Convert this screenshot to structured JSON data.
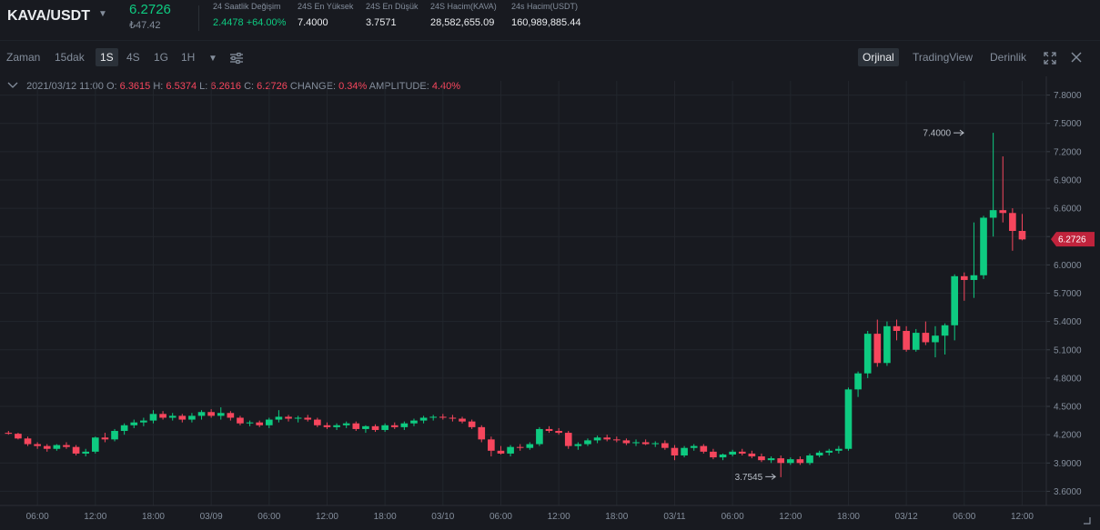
{
  "header": {
    "pair": "KAVA/USDT",
    "last_price": "6.2726",
    "fiat_price": "₺47.42",
    "stats": [
      {
        "label": "24 Saatlik Değişim",
        "value": "2.4478 +64.00%",
        "up": true
      },
      {
        "label": "24S En Yüksek",
        "value": "7.4000",
        "up": false
      },
      {
        "label": "24S En Düşük",
        "value": "3.7571",
        "up": false
      },
      {
        "label": "24S Hacim(KAVA)",
        "value": "28,582,655.09",
        "up": false
      },
      {
        "label": "24s Hacim(USDT)",
        "value": "160,989,885.44",
        "up": false
      }
    ]
  },
  "toolbar": {
    "time_label": "Zaman",
    "intervals": [
      "15dak",
      "1S",
      "4S",
      "1G",
      "1H"
    ],
    "active_interval": "1S",
    "views": [
      "Orjinal",
      "TradingView",
      "Derinlik"
    ],
    "active_view": "Orjinal"
  },
  "ohlc": {
    "date": "2021/03/12 11:00",
    "o_label": "O:",
    "o": "6.3615",
    "h_label": "H:",
    "h": "6.5374",
    "l_label": "L:",
    "l": "6.2616",
    "c_label": "C:",
    "c": "6.2726",
    "change_label": "CHANGE:",
    "change": "0.34%",
    "amp_label": "AMPLITUDE:",
    "amp": "4.40%"
  },
  "colors": {
    "up": "#0ecb81",
    "down": "#f6465d",
    "bg": "#181a20",
    "grid": "#22262d",
    "axis_text": "#848e9c",
    "price_tag": "#c0233c"
  },
  "chart_data": {
    "type": "candlestick",
    "y_ticks": [
      "7.8000",
      "7.5000",
      "7.2000",
      "6.9000",
      "6.6000",
      "6.3000",
      "6.0000",
      "5.7000",
      "5.4000",
      "5.1000",
      "4.8000",
      "4.5000",
      "4.2000",
      "3.9000",
      "3.6000"
    ],
    "y_tick_values": [
      7.8,
      7.5,
      7.2,
      6.9,
      6.6,
      6.3,
      6.0,
      5.7,
      5.4,
      5.1,
      4.8,
      4.5,
      4.2,
      3.9,
      3.6
    ],
    "ylim": [
      3.45,
      7.95
    ],
    "x_ticks": [
      "06:00",
      "12:00",
      "18:00",
      "03/09",
      "06:00",
      "12:00",
      "18:00",
      "03/10",
      "06:00",
      "12:00",
      "18:00",
      "03/11",
      "06:00",
      "12:00",
      "18:00",
      "03/12",
      "06:00",
      "12:00"
    ],
    "x_tick_index": [
      3,
      9,
      15,
      21,
      27,
      33,
      39,
      45,
      51,
      57,
      63,
      69,
      75,
      81,
      87,
      93,
      99,
      105
    ],
    "candle_count": 108,
    "current_price_label": "6.2726",
    "current_price": 6.2726,
    "high_marker": {
      "label": "7.4000",
      "index": 101,
      "value": 7.4
    },
    "low_marker": {
      "label": "3.7545",
      "index": 80,
      "value": 3.7545
    },
    "candles": [
      [
        4.22,
        4.24,
        4.2,
        4.21
      ],
      [
        4.21,
        4.22,
        4.15,
        4.16
      ],
      [
        4.16,
        4.18,
        4.08,
        4.1
      ],
      [
        4.1,
        4.12,
        4.05,
        4.08
      ],
      [
        4.08,
        4.1,
        4.02,
        4.05
      ],
      [
        4.05,
        4.1,
        4.03,
        4.09
      ],
      [
        4.09,
        4.12,
        4.05,
        4.07
      ],
      [
        4.07,
        4.09,
        3.98,
        4.0
      ],
      [
        4.0,
        4.05,
        3.97,
        4.02
      ],
      [
        4.02,
        4.18,
        4.0,
        4.17
      ],
      [
        4.17,
        4.22,
        4.12,
        4.15
      ],
      [
        4.15,
        4.26,
        4.13,
        4.24
      ],
      [
        4.24,
        4.32,
        4.2,
        4.3
      ],
      [
        4.3,
        4.36,
        4.27,
        4.33
      ],
      [
        4.33,
        4.38,
        4.29,
        4.35
      ],
      [
        4.35,
        4.46,
        4.32,
        4.42
      ],
      [
        4.42,
        4.45,
        4.36,
        4.38
      ],
      [
        4.38,
        4.43,
        4.35,
        4.4
      ],
      [
        4.4,
        4.42,
        4.33,
        4.36
      ],
      [
        4.36,
        4.43,
        4.33,
        4.4
      ],
      [
        4.4,
        4.46,
        4.36,
        4.44
      ],
      [
        4.44,
        4.47,
        4.38,
        4.4
      ],
      [
        4.4,
        4.49,
        4.36,
        4.43
      ],
      [
        4.43,
        4.45,
        4.35,
        4.38
      ],
      [
        4.38,
        4.4,
        4.3,
        4.32
      ],
      [
        4.32,
        4.35,
        4.29,
        4.33
      ],
      [
        4.33,
        4.35,
        4.28,
        4.3
      ],
      [
        4.3,
        4.38,
        4.27,
        4.36
      ],
      [
        4.36,
        4.46,
        4.33,
        4.39
      ],
      [
        4.39,
        4.41,
        4.34,
        4.37
      ],
      [
        4.37,
        4.4,
        4.33,
        4.38
      ],
      [
        4.38,
        4.41,
        4.34,
        4.36
      ],
      [
        4.36,
        4.38,
        4.28,
        4.3
      ],
      [
        4.3,
        4.33,
        4.26,
        4.28
      ],
      [
        4.28,
        4.32,
        4.25,
        4.3
      ],
      [
        4.3,
        4.34,
        4.27,
        4.32
      ],
      [
        4.32,
        4.34,
        4.24,
        4.26
      ],
      [
        4.26,
        4.3,
        4.22,
        4.29
      ],
      [
        4.29,
        4.31,
        4.23,
        4.25
      ],
      [
        4.25,
        4.32,
        4.23,
        4.3
      ],
      [
        4.3,
        4.33,
        4.26,
        4.28
      ],
      [
        4.28,
        4.34,
        4.25,
        4.32
      ],
      [
        4.32,
        4.37,
        4.29,
        4.35
      ],
      [
        4.35,
        4.4,
        4.32,
        4.38
      ],
      [
        4.38,
        4.41,
        4.35,
        4.39
      ],
      [
        4.39,
        4.42,
        4.36,
        4.38
      ],
      [
        4.38,
        4.41,
        4.34,
        4.37
      ],
      [
        4.37,
        4.39,
        4.32,
        4.34
      ],
      [
        4.34,
        4.36,
        4.26,
        4.28
      ],
      [
        4.28,
        4.3,
        4.12,
        4.15
      ],
      [
        4.15,
        4.18,
        3.97,
        4.03
      ],
      [
        4.03,
        4.08,
        3.99,
        4.0
      ],
      [
        4.0,
        4.09,
        3.97,
        4.07
      ],
      [
        4.07,
        4.1,
        4.03,
        4.06
      ],
      [
        4.06,
        4.12,
        4.04,
        4.1
      ],
      [
        4.1,
        4.28,
        4.08,
        4.26
      ],
      [
        4.26,
        4.29,
        4.22,
        4.24
      ],
      [
        4.24,
        4.27,
        4.2,
        4.22
      ],
      [
        4.22,
        4.24,
        4.05,
        4.08
      ],
      [
        4.08,
        4.12,
        4.04,
        4.1
      ],
      [
        4.1,
        4.16,
        4.08,
        4.14
      ],
      [
        4.14,
        4.19,
        4.11,
        4.17
      ],
      [
        4.17,
        4.2,
        4.13,
        4.15
      ],
      [
        4.15,
        4.18,
        4.12,
        4.14
      ],
      [
        4.14,
        4.16,
        4.09,
        4.11
      ],
      [
        4.11,
        4.15,
        4.08,
        4.12
      ],
      [
        4.12,
        4.15,
        4.09,
        4.1
      ],
      [
        4.1,
        4.13,
        4.07,
        4.11
      ],
      [
        4.11,
        4.14,
        4.04,
        4.06
      ],
      [
        4.06,
        4.09,
        3.93,
        3.98
      ],
      [
        3.98,
        4.08,
        3.96,
        4.06
      ],
      [
        4.06,
        4.1,
        4.03,
        4.08
      ],
      [
        4.08,
        4.1,
        4.0,
        4.02
      ],
      [
        4.02,
        4.05,
        3.94,
        3.96
      ],
      [
        3.96,
        4.0,
        3.93,
        3.99
      ],
      [
        3.99,
        4.04,
        3.97,
        4.02
      ],
      [
        4.02,
        4.05,
        3.98,
        4.0
      ],
      [
        4.0,
        4.03,
        3.95,
        3.97
      ],
      [
        3.97,
        4.0,
        3.91,
        3.93
      ],
      [
        3.93,
        3.97,
        3.9,
        3.95
      ],
      [
        3.95,
        3.98,
        3.75,
        3.9
      ],
      [
        3.9,
        3.96,
        3.88,
        3.94
      ],
      [
        3.94,
        3.97,
        3.88,
        3.9
      ],
      [
        3.9,
        4.0,
        3.88,
        3.98
      ],
      [
        3.98,
        4.03,
        3.96,
        4.01
      ],
      [
        4.01,
        4.05,
        3.98,
        4.03
      ],
      [
        4.03,
        4.08,
        4.0,
        4.05
      ],
      [
        4.05,
        4.7,
        4.03,
        4.68
      ],
      [
        4.68,
        4.87,
        4.6,
        4.85
      ],
      [
        4.85,
        5.3,
        4.8,
        5.27
      ],
      [
        5.27,
        5.42,
        4.92,
        4.96
      ],
      [
        4.96,
        5.4,
        4.93,
        5.35
      ],
      [
        5.35,
        5.42,
        5.2,
        5.3
      ],
      [
        5.3,
        5.35,
        5.08,
        5.1
      ],
      [
        5.1,
        5.32,
        5.08,
        5.28
      ],
      [
        5.28,
        5.4,
        5.15,
        5.18
      ],
      [
        5.18,
        5.35,
        5.02,
        5.25
      ],
      [
        5.25,
        5.38,
        5.05,
        5.36
      ],
      [
        5.36,
        5.9,
        5.2,
        5.88
      ],
      [
        5.88,
        5.92,
        5.62,
        5.84
      ],
      [
        5.84,
        6.45,
        5.65,
        5.89
      ],
      [
        5.89,
        6.52,
        5.85,
        6.5
      ],
      [
        6.5,
        7.4,
        6.3,
        6.58
      ],
      [
        6.58,
        7.15,
        6.45,
        6.55
      ],
      [
        6.55,
        6.6,
        6.15,
        6.36
      ],
      [
        6.36,
        6.54,
        6.26,
        6.27
      ]
    ]
  }
}
